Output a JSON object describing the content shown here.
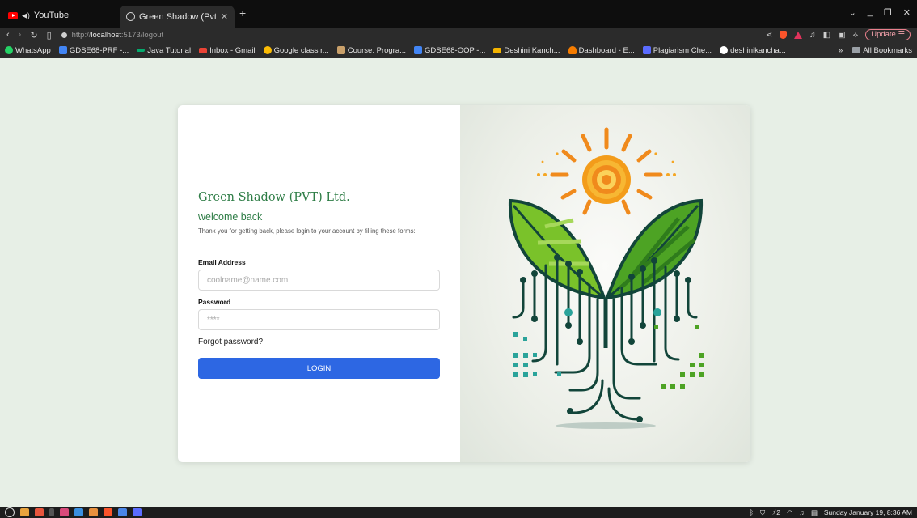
{
  "browser": {
    "tabs": [
      {
        "label": "YouTube",
        "active": false
      },
      {
        "label": "Green Shadow (Pvt) Ltd.",
        "active": true
      }
    ],
    "url": {
      "scheme_host_prefix": "http://",
      "host": "localhost",
      "rest": ":5173/logout"
    },
    "update_label": "Update",
    "bookmarks": [
      {
        "label": "WhatsApp",
        "color": "#25d366"
      },
      {
        "label": "GDSE68-PRF -...",
        "color": "#4285f4"
      },
      {
        "label": "Java Tutorial",
        "color": "#04aa6d"
      },
      {
        "label": "Inbox - Gmail",
        "color": "#ea4335"
      },
      {
        "label": "Google class r...",
        "color": "#fbbc04"
      },
      {
        "label": "Course: Progra...",
        "color": "#c9a06a"
      },
      {
        "label": "GDSE68-OOP -...",
        "color": "#4285f4"
      },
      {
        "label": "Deshini Kanch...",
        "color": "#f4b400"
      },
      {
        "label": "Dashboard - E...",
        "color": "#f57c00"
      },
      {
        "label": "Plagiarism Che...",
        "color": "#5b6cff"
      },
      {
        "label": "deshinikancha...",
        "color": "#ffffff"
      }
    ],
    "more_label": "»",
    "all_bookmarks_label": "All Bookmarks"
  },
  "login": {
    "brand": "Green Shadow (PVT) Ltd.",
    "welcome": "welcome back",
    "subtitle": "Thank you for getting back, please login to your account by filling these forms:",
    "email_label": "Email Address",
    "email_placeholder": "coolname@name.com",
    "password_label": "Password",
    "password_placeholder": "****",
    "forgot_label": "Forgot password?",
    "login_label": "LOGIN"
  },
  "taskbar": {
    "battery_label": "2",
    "datetime": "Sunday January 19, 8:36 AM"
  },
  "colors": {
    "brand_green": "#2e7d46",
    "primary_button": "#2d67e3",
    "page_bg": "#e7efe6"
  }
}
